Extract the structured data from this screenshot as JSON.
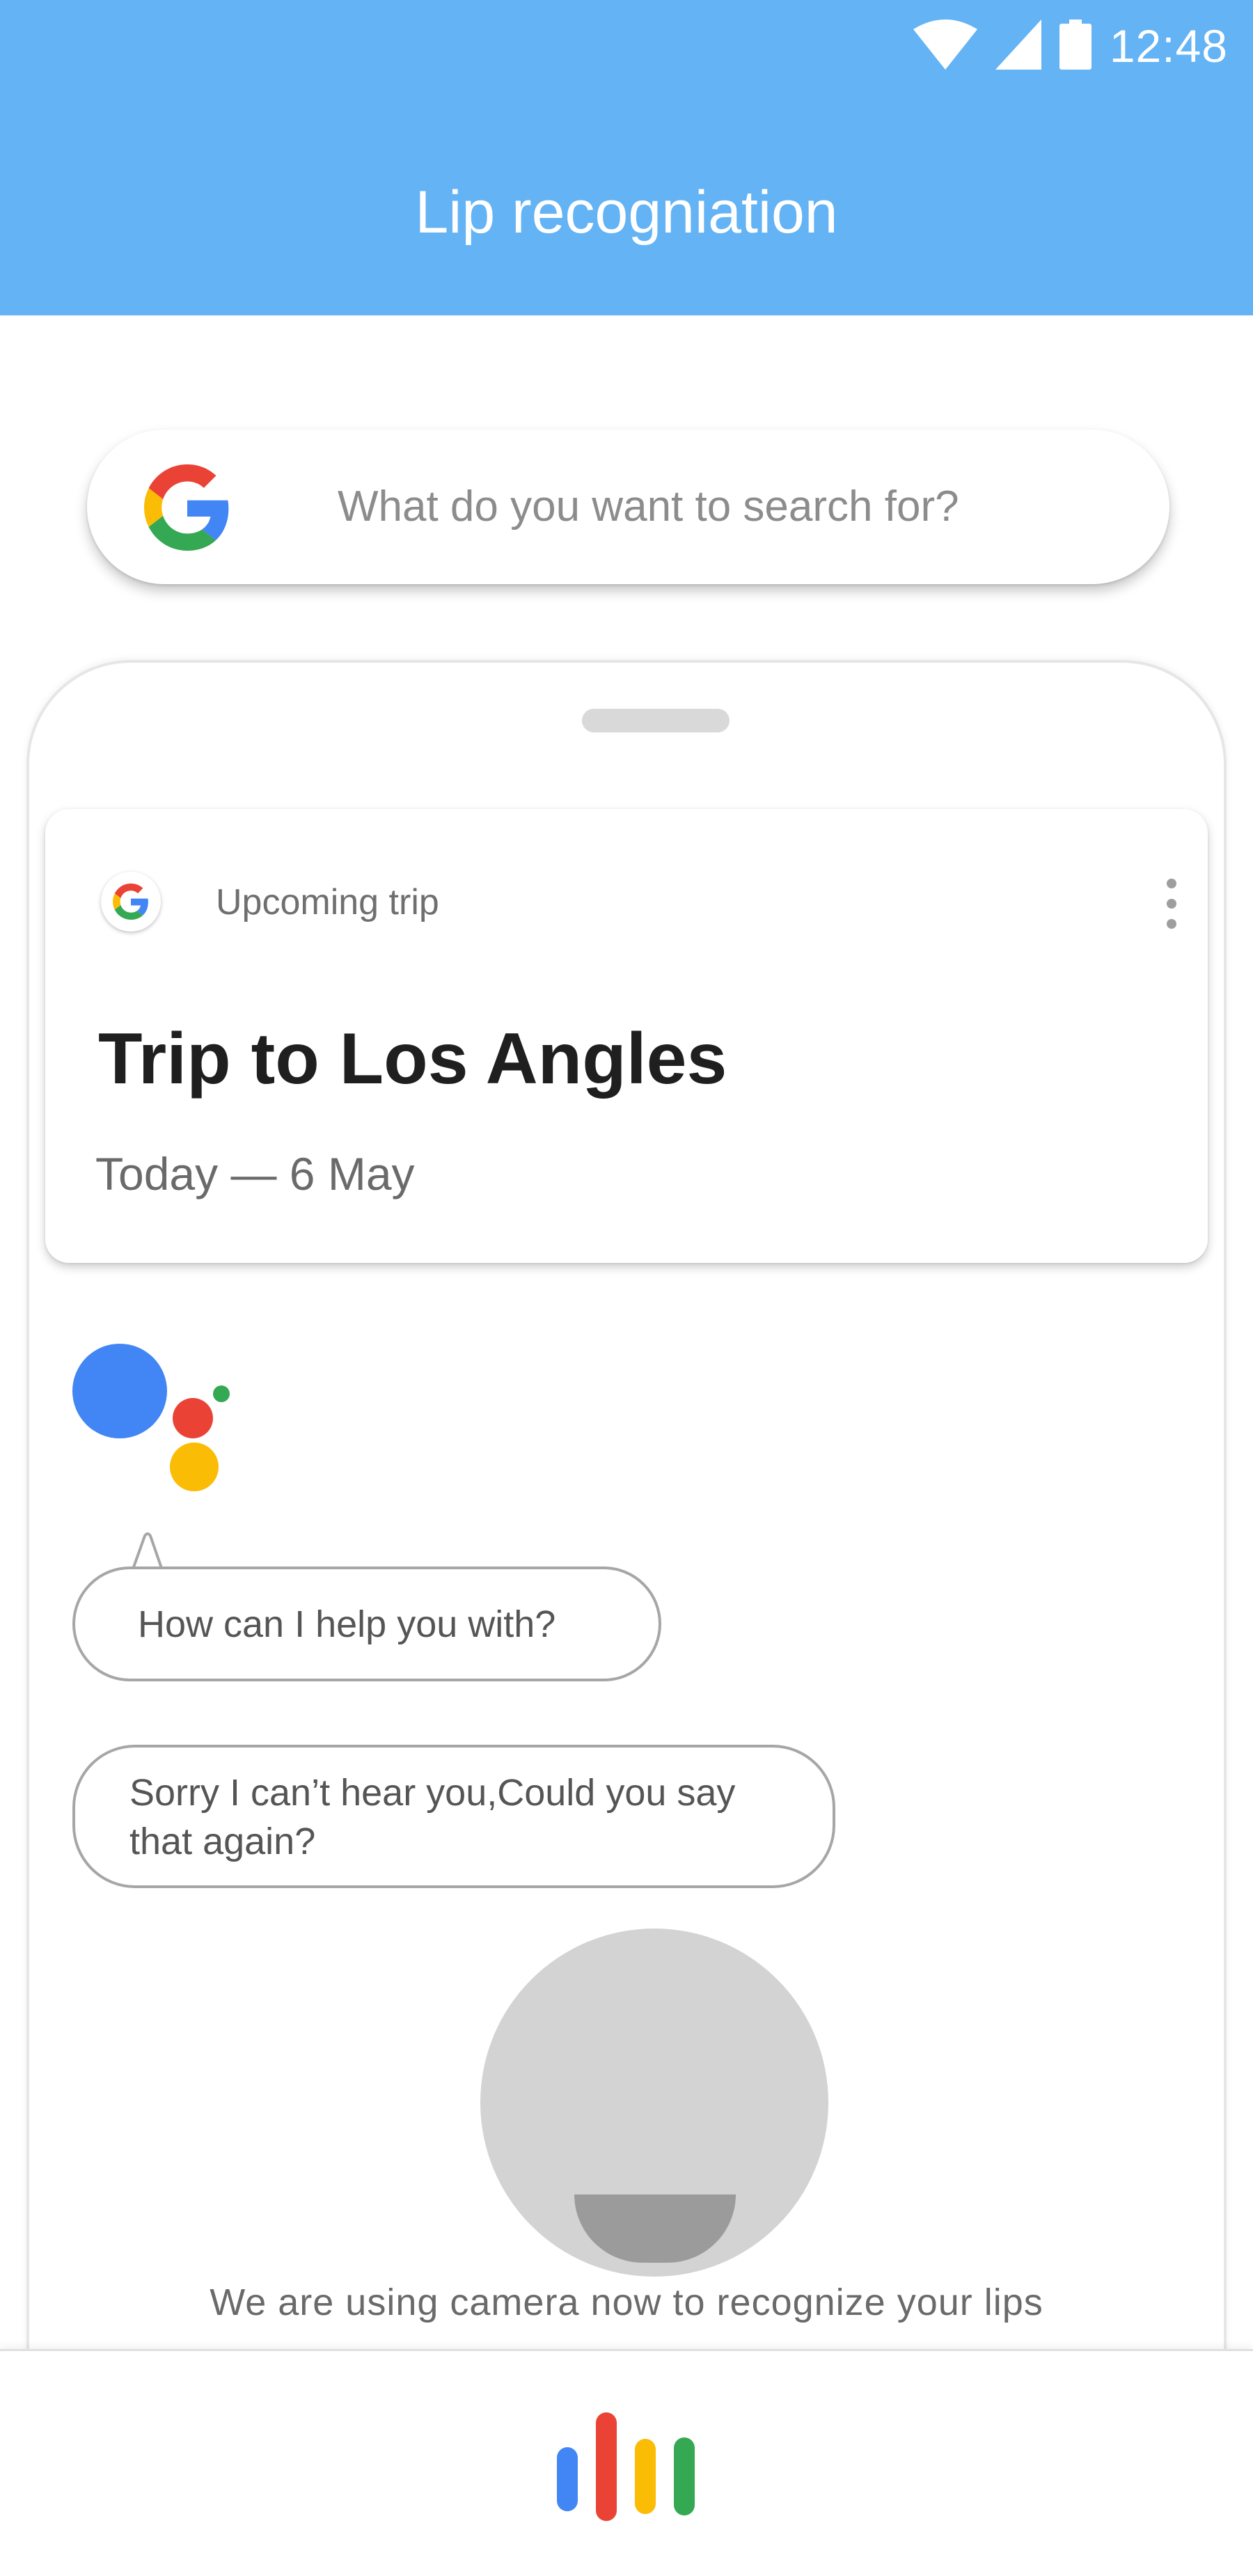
{
  "status_bar": {
    "time": "12:48",
    "icons": [
      "wifi-icon",
      "signal-icon",
      "battery-icon"
    ]
  },
  "header": {
    "title": "Lip recogniation",
    "color": "#64b3f4"
  },
  "search": {
    "placeholder": "What do you want to search for?",
    "icon": "google-g-icon"
  },
  "trip_card": {
    "label": "Upcoming trip",
    "title": "Trip to Los Angles",
    "date": "Today — 6 May",
    "menu_icon": "more-vert-icon"
  },
  "chat": {
    "assistant_message": "How can I help you with?",
    "user_message": "Sorry I can’t hear you,Could you say that again?"
  },
  "camera": {
    "hint": "We are using camera now to recognize your lips"
  },
  "colors": {
    "google_blue": "#4285f4",
    "google_red": "#ea4335",
    "google_yellow": "#fbbc05",
    "google_green": "#34a853"
  }
}
